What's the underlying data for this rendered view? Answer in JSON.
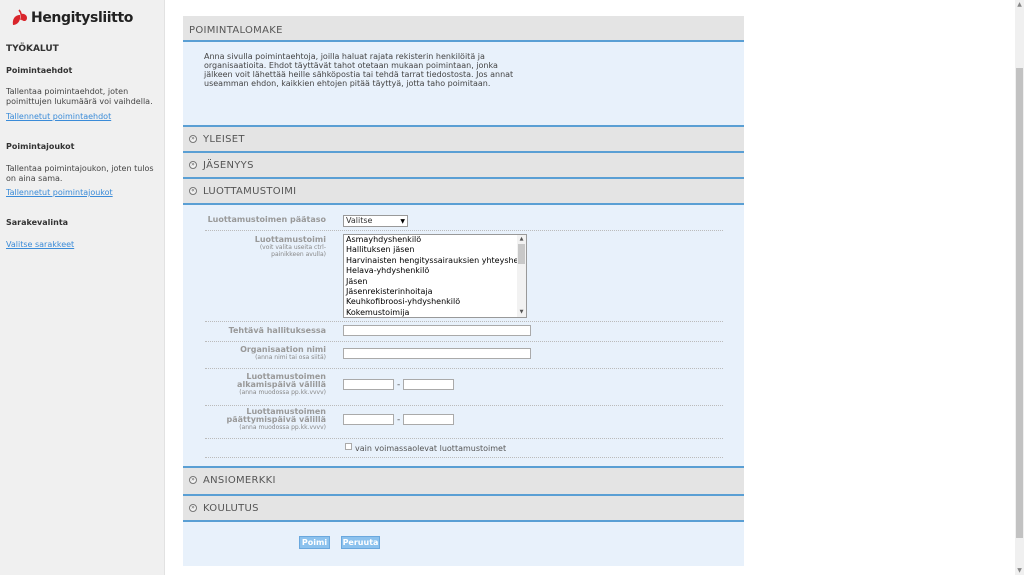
{
  "sidebar": {
    "logo_text": "Hengitysliitto",
    "heading_tools": "TYÖKALUT",
    "groups": [
      {
        "title": "Poimintaehdot",
        "text": "Tallentaa poimintaehdot, joten poimittujen lukumäärä voi vaihdella.",
        "link": "Tallennetut poimintaehdot"
      },
      {
        "title": "Poimintajoukot",
        "text": "Tallentaa poimintajoukon, joten tulos on aina sama.",
        "link": "Tallennetut poimintajoukot"
      },
      {
        "title": "Sarakevalinta",
        "text": "",
        "link": "Valitse sarakkeet"
      }
    ]
  },
  "panel": {
    "title": "POIMINTALOMAKE",
    "intro": "Anna sivulla poimintaehtoja, joilla haluat rajata rekisterin henkilöitä ja organisaatioita. Ehdot täyttävät tahot otetaan mukaan poimintaan, jonka jälkeen voit lähettää heille sähköpostia tai tehdä tarrat tiedostosta. Jos annat useamman ehdon, kaikkien ehtojen pitää täyttyä, jotta taho poimitaan.",
    "sections": {
      "yleiset": "YLEISET",
      "jasenyys": "JÄSENYYS",
      "luottamustoimi": "LUOTTAMUSTOIMI",
      "ansiomerkki": "ANSIOMERKKI",
      "koulutus": "KOULUTUS"
    }
  },
  "form": {
    "paataso_label": "Luottamustoimen päätaso",
    "paataso_value": "Valitse",
    "luottamustoimi_label": "Luottamustoimi",
    "luottamustoimi_hint": "(voit valita useita ctrl-painikkeen avulla)",
    "luottamustoimi_options": [
      "Asmayhdyshenkilö",
      "Hallituksen jäsen",
      "Harvinaisten hengityssairauksien yhteyshenkilö",
      "Helava-yhdyshenkilö",
      "Jäsen",
      "Jäsenrekisterinhoitaja",
      "Keuhkofibroosi-yhdyshenkilö",
      "Kokemustoimija"
    ],
    "tehtava_label": "Tehtävä hallituksessa",
    "organisaatio_label": "Organisaation nimi",
    "organisaatio_hint": "(anna nimi tai osa siitä)",
    "alkamis_label": "Luottamustoimen alkamispäivä välillä",
    "alkamis_hint": "(anna muodossa pp.kk.vvvv)",
    "paattymis_label": "Luottamustoimen päättymispäivä välillä",
    "paattymis_hint": "(anna muodossa pp.kk.vvvv)",
    "range_sep": "-",
    "checkbox_label": "vain voimassaolevat luottamustoimet"
  },
  "buttons": {
    "poimi": "Poimi",
    "peruuta": "Peruuta"
  },
  "colors": {
    "accent_blue": "#5a9fd4",
    "link_blue": "#3a8bd8",
    "logo_red": "#d9242b",
    "button_blue": "#8cc2ee"
  }
}
